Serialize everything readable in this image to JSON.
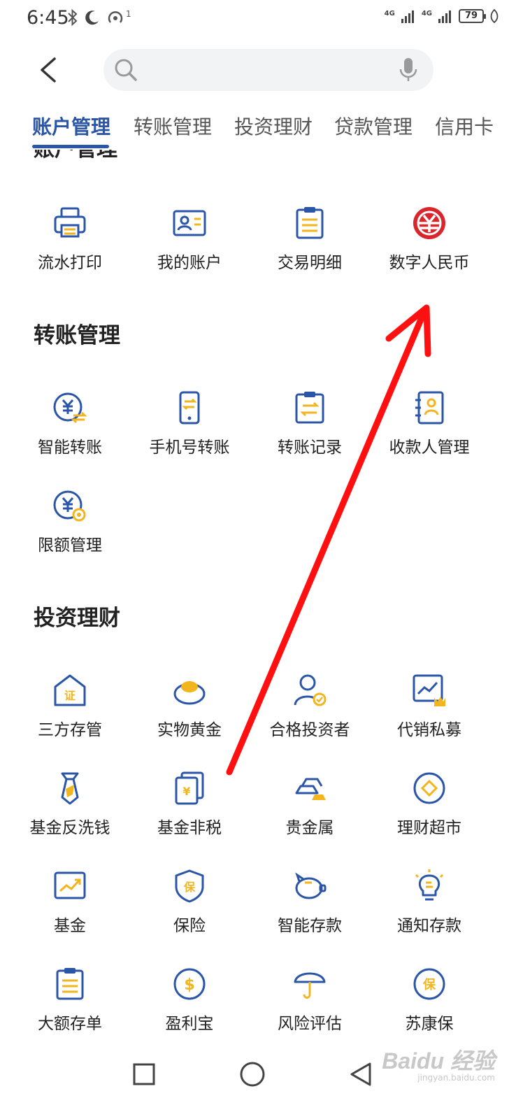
{
  "status_bar": {
    "time": "6:45",
    "battery": "79",
    "network_1": "4G",
    "network_2": "4G",
    "notification_count": "1"
  },
  "search": {
    "placeholder": ""
  },
  "tabs": [
    {
      "label": "账户管理",
      "active": true
    },
    {
      "label": "转账管理",
      "active": false
    },
    {
      "label": "投资理财",
      "active": false
    },
    {
      "label": "贷款管理",
      "active": false
    },
    {
      "label": "信用卡",
      "active": false
    }
  ],
  "account_section": {
    "items": [
      {
        "label": "流水打印",
        "icon": "printer-icon"
      },
      {
        "label": "我的账户",
        "icon": "id-card-icon"
      },
      {
        "label": "交易明细",
        "icon": "clipboard-list-icon"
      },
      {
        "label": "数字人民币",
        "icon": "digital-rmb-icon"
      }
    ]
  },
  "transfer_section": {
    "title": "转账管理",
    "items": [
      {
        "label": "智能转账",
        "icon": "yuan-transfer-icon"
      },
      {
        "label": "手机号转账",
        "icon": "phone-transfer-icon"
      },
      {
        "label": "转账记录",
        "icon": "transfer-record-icon"
      },
      {
        "label": "收款人管理",
        "icon": "payee-book-icon"
      },
      {
        "label": "限额管理",
        "icon": "yuan-gear-icon"
      }
    ]
  },
  "invest_section": {
    "title": "投资理财",
    "items": [
      {
        "label": "三方存管",
        "icon": "certificate-house-icon"
      },
      {
        "label": "实物黄金",
        "icon": "gold-ingot-icon"
      },
      {
        "label": "合格投资者",
        "icon": "investor-user-icon"
      },
      {
        "label": "代销私募",
        "icon": "chart-crown-icon"
      },
      {
        "label": "基金反洗钱",
        "icon": "tie-icon"
      },
      {
        "label": "基金非税",
        "icon": "yuan-cards-icon"
      },
      {
        "label": "贵金属",
        "icon": "gold-bars-icon"
      },
      {
        "label": "理财超市",
        "icon": "coin-diamond-icon"
      },
      {
        "label": "基金",
        "icon": "trend-chart-icon"
      },
      {
        "label": "保险",
        "icon": "shield-bao-icon"
      },
      {
        "label": "智能存款",
        "icon": "piggy-bank-icon"
      },
      {
        "label": "通知存款",
        "icon": "lightbulb-icon"
      },
      {
        "label": "大额存单",
        "icon": "document-list-icon"
      },
      {
        "label": "盈利宝",
        "icon": "dollar-coin-icon"
      },
      {
        "label": "风险评估",
        "icon": "umbrella-icon"
      },
      {
        "label": "苏康保",
        "icon": "bao-badge-icon"
      }
    ]
  },
  "watermark": {
    "brand": "Baidu 经验",
    "url": "jingyan.baidu.com"
  },
  "colors": {
    "accent_blue": "#2b56a8",
    "icon_yellow": "#f2b51e",
    "rmb_red": "#d9262c",
    "annotation_red": "#ff1010"
  }
}
